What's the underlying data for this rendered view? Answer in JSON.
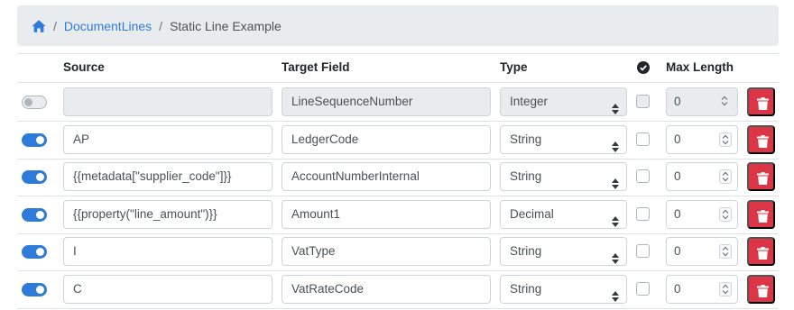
{
  "breadcrumb": {
    "home_icon": "home-icon",
    "link_label": "DocumentLines",
    "current_label": "Static Line Example",
    "separator": "/"
  },
  "table": {
    "headers": {
      "source": "Source",
      "target": "Target Field",
      "type": "Type",
      "required_icon": "check-circle-icon",
      "max_length": "Max Length"
    },
    "rows": [
      {
        "enabled": false,
        "source": "",
        "target": "LineSequenceNumber",
        "type": "Integer",
        "checked": false,
        "max_length": "0",
        "disabled": true
      },
      {
        "enabled": true,
        "source": "AP",
        "target": "LedgerCode",
        "type": "String",
        "checked": false,
        "max_length": "0",
        "disabled": false
      },
      {
        "enabled": true,
        "source": "{{metadata[\"supplier_code\"]}}",
        "target": "AccountNumberInternal",
        "type": "String",
        "checked": false,
        "max_length": "0",
        "disabled": false
      },
      {
        "enabled": true,
        "source": "{{property(\"line_amount\")}}",
        "target": "Amount1",
        "type": "Decimal",
        "checked": false,
        "max_length": "0",
        "disabled": false
      },
      {
        "enabled": true,
        "source": "I",
        "target": "VatType",
        "type": "String",
        "checked": false,
        "max_length": "0",
        "disabled": false
      },
      {
        "enabled": true,
        "source": "C",
        "target": "VatRateCode",
        "type": "String",
        "checked": false,
        "max_length": "0",
        "disabled": false
      }
    ]
  },
  "colors": {
    "accent": "#2f7bd9",
    "danger": "#dc3545",
    "breadcrumb_bg": "#e9ecef"
  }
}
